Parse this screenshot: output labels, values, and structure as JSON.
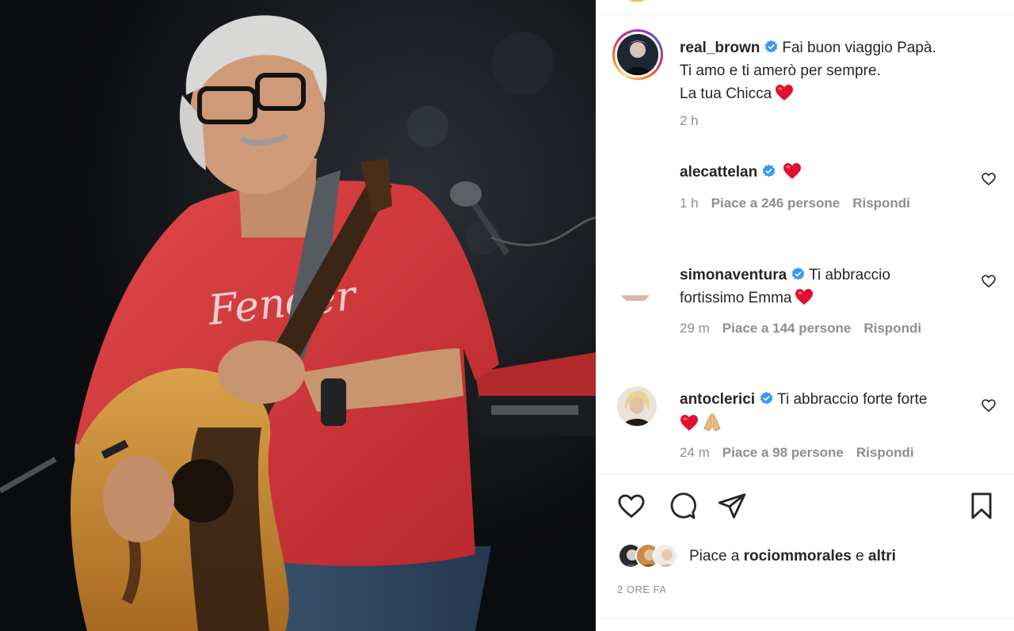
{
  "post": {
    "author": "real_brown",
    "caption_lines": [
      "Fai buon viaggio Papà.",
      "Ti amo e ti amerò per sempre.",
      "La tua Chicca"
    ],
    "caption_time": "2 h",
    "photo_alt_icon": "concert-photo"
  },
  "comments": [
    {
      "user": "alecattelan",
      "text": "",
      "time": "1 h",
      "likes": "Piace a 246 persone",
      "reply": "Rispondi"
    },
    {
      "user": "simonaventura",
      "text_line1": "Ti abbraccio",
      "text_line2": "fortissimo Emma",
      "time": "29 m",
      "likes": "Piace a 144 persone",
      "reply": "Rispondi"
    },
    {
      "user": "antoclerici",
      "text": "Ti abbraccio forte forte",
      "time": "24 m",
      "likes": "Piace a 98 persone",
      "reply": "Rispondi"
    }
  ],
  "likes": {
    "prefix": "Piace a",
    "user": "rociommorales",
    "joiner": "e",
    "others": "altri"
  },
  "post_time": "2 ORE FA",
  "icons": {
    "verified": "verified-badge-icon",
    "heart": "heart-icon",
    "comment": "comment-icon",
    "share": "share-icon",
    "save": "bookmark-icon"
  },
  "colors": {
    "verified": "#3897f0",
    "heart_emoji": "#e0102e",
    "meta": "#8e8e8e",
    "text": "#262626"
  }
}
